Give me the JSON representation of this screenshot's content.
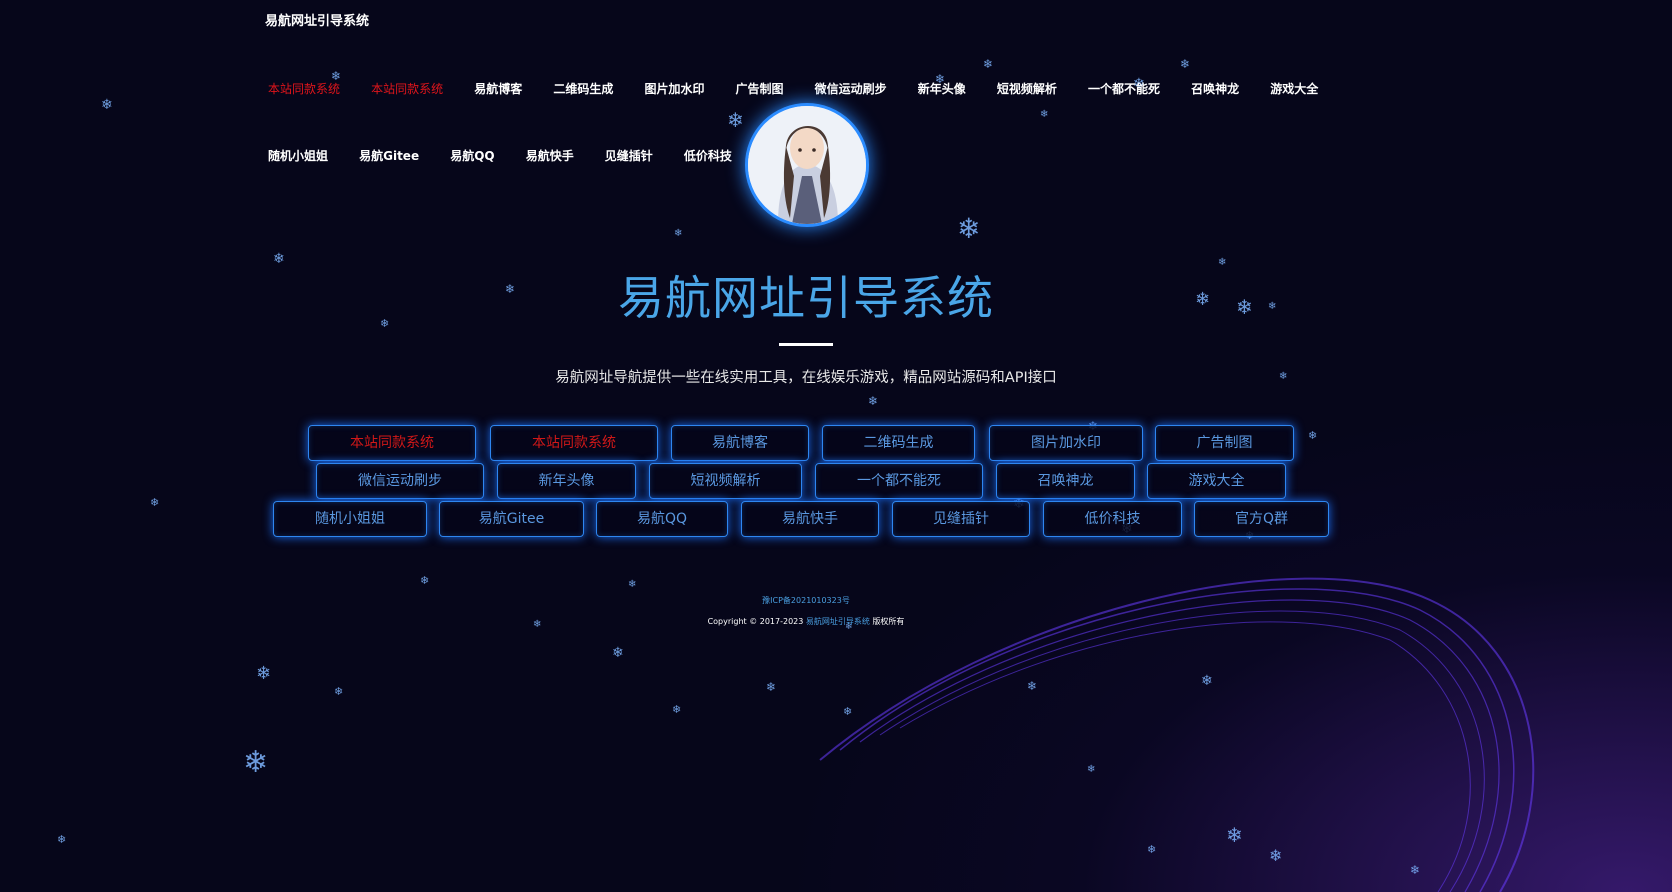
{
  "site": {
    "title": "易航网址引导系统"
  },
  "nav": {
    "row1": [
      {
        "label": "本站同款系统",
        "red": true
      },
      {
        "label": "本站同款系统",
        "red": true
      },
      {
        "label": "易航博客",
        "red": false
      },
      {
        "label": "二维码生成",
        "red": false
      },
      {
        "label": "图片加水印",
        "red": false
      },
      {
        "label": "广告制图",
        "red": false
      },
      {
        "label": "微信运动刷步",
        "red": false
      },
      {
        "label": "新年头像",
        "red": false
      },
      {
        "label": "短视频解析",
        "red": false
      },
      {
        "label": "一个都不能死",
        "red": false
      },
      {
        "label": "召唤神龙",
        "red": false
      },
      {
        "label": "游戏大全",
        "red": false
      }
    ],
    "row2": [
      {
        "label": "随机小姐姐",
        "red": false
      },
      {
        "label": "易航Gitee",
        "red": false
      },
      {
        "label": "易航QQ",
        "red": false
      },
      {
        "label": "易航快手",
        "red": false
      },
      {
        "label": "见缝插针",
        "red": false
      },
      {
        "label": "低价科技",
        "red": false
      }
    ]
  },
  "hero": {
    "title": "易航网址引导系统",
    "subtitle": "易航网址导航提供一些在线实用工具，在线娱乐游戏，精品网站源码和API接口"
  },
  "buttons": {
    "row1": [
      {
        "label": "本站同款系统",
        "red": true
      },
      {
        "label": "本站同款系统",
        "red": true
      },
      {
        "label": "易航博客",
        "red": false
      },
      {
        "label": "二维码生成",
        "red": false
      },
      {
        "label": "图片加水印",
        "red": false
      },
      {
        "label": "广告制图",
        "red": false
      }
    ],
    "row2": [
      {
        "label": "微信运动刷步",
        "red": false
      },
      {
        "label": "新年头像",
        "red": false
      },
      {
        "label": "短视频解析",
        "red": false
      },
      {
        "label": "一个都不能死",
        "red": false
      },
      {
        "label": "召唤神龙",
        "red": false
      },
      {
        "label": "游戏大全",
        "red": false
      }
    ],
    "row3": [
      {
        "label": "随机小姐姐",
        "red": false
      },
      {
        "label": "易航Gitee",
        "red": false
      },
      {
        "label": "易航QQ",
        "red": false
      },
      {
        "label": "易航快手",
        "red": false
      },
      {
        "label": "见缝插针",
        "red": false
      },
      {
        "label": "低价科技",
        "red": false
      },
      {
        "label": "官方Q群",
        "red": false
      }
    ]
  },
  "footer": {
    "icp": "豫ICP备2021010323号",
    "copyright_prefix": "Copyright © 2017-2023",
    "copyright_link": "易航网址引导系统",
    "copyright_suffix": "版权所有"
  },
  "colors": {
    "accent_blue": "#4aa6e8",
    "red": "#e0151b",
    "button_border": "#2e86f0",
    "background": "#06061a"
  }
}
